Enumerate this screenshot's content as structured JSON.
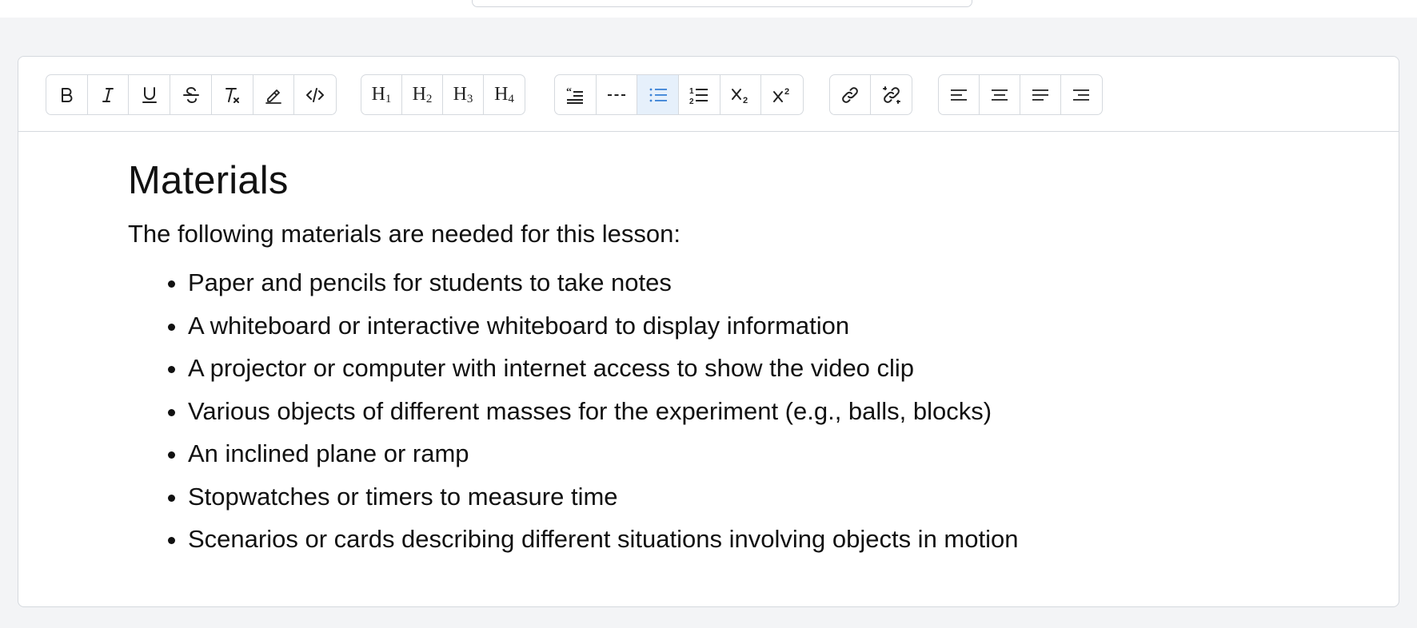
{
  "toolbar": {
    "format_buttons": [
      {
        "name": "bold-button",
        "icon": "bold-icon"
      },
      {
        "name": "italic-button",
        "icon": "italic-icon"
      },
      {
        "name": "underline-button",
        "icon": "underline-icon"
      },
      {
        "name": "strikethrough-button",
        "icon": "strikethrough-icon"
      },
      {
        "name": "clear-format-button",
        "icon": "clear-format-icon"
      },
      {
        "name": "highlight-button",
        "icon": "highlighter-icon"
      },
      {
        "name": "code-button",
        "icon": "code-icon"
      }
    ],
    "heading_buttons": [
      {
        "name": "heading-1-button",
        "letter": "H",
        "level": "1"
      },
      {
        "name": "heading-2-button",
        "letter": "H",
        "level": "2"
      },
      {
        "name": "heading-3-button",
        "letter": "H",
        "level": "3"
      },
      {
        "name": "heading-4-button",
        "letter": "H",
        "level": "4"
      }
    ],
    "block_buttons": [
      {
        "name": "blockquote-button",
        "icon": "quote-icon"
      },
      {
        "name": "horizontal-rule-button",
        "icon": "horizontal-rule-icon"
      },
      {
        "name": "bullet-list-button",
        "icon": "bullet-list-icon",
        "active": true
      },
      {
        "name": "ordered-list-button",
        "icon": "ordered-list-icon"
      },
      {
        "name": "subscript-button",
        "icon": "subscript-icon"
      },
      {
        "name": "superscript-button",
        "icon": "superscript-icon"
      }
    ],
    "link_buttons": [
      {
        "name": "link-button",
        "icon": "link-icon"
      },
      {
        "name": "unlink-button",
        "icon": "unlink-icon"
      }
    ],
    "align_buttons": [
      {
        "name": "align-left-button",
        "icon": "align-left-icon"
      },
      {
        "name": "align-center-button",
        "icon": "align-center-icon"
      },
      {
        "name": "align-justify-button",
        "icon": "align-justify-icon"
      },
      {
        "name": "align-right-button",
        "icon": "align-right-icon"
      }
    ],
    "active_color": "#3b82d6"
  },
  "document": {
    "heading": "Materials",
    "intro": "The following materials are needed for this lesson:",
    "items": [
      "Paper and pencils for students to take notes",
      "A whiteboard or interactive whiteboard to display information",
      "A projector or computer with internet access to show the video clip",
      "Various objects of different masses for the experiment (e.g., balls, blocks)",
      "An inclined plane or ramp",
      "Stopwatches or timers to measure time",
      "Scenarios or cards describing different situations involving objects in motion"
    ]
  }
}
